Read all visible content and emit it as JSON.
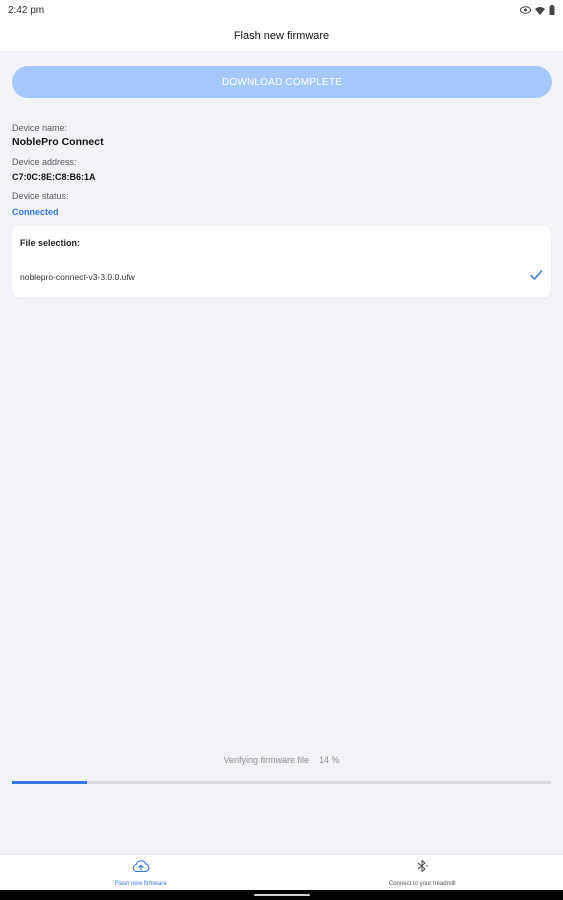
{
  "status_bar": {
    "time": "2:42 pm",
    "icons": [
      "eye-icon",
      "wifi-icon",
      "battery-icon"
    ]
  },
  "header": {
    "title": "Flash new firmware"
  },
  "download_button": {
    "label": "DOWNLOAD COMPLETE",
    "color": "#a5c8fb"
  },
  "device": {
    "name_label": "Device name:",
    "name": "NoblePro Connect",
    "address_label": "Device address:",
    "address": "C7:0C:8E:C8:B6:1A",
    "status_label": "Device status:",
    "status": "Connected",
    "status_color": "#3477e3"
  },
  "file_selection": {
    "title": "File selection:",
    "file_name": "noblepro-connect-v3-3.0.0.ufw",
    "selected": true,
    "check_icon": "check-icon"
  },
  "progress": {
    "label": "Verifying firmware file",
    "percent_text": "14 %",
    "value": 0.14
  },
  "bottom_nav": {
    "items": [
      {
        "label": "Flash new firmware",
        "icon": "cloud-upload-icon",
        "active": true
      },
      {
        "label": "Connect to your treadmill",
        "icon": "bluetooth-icon",
        "active": false
      }
    ]
  },
  "colors": {
    "accent": "#3477e3",
    "background": "#f2f3f8"
  }
}
